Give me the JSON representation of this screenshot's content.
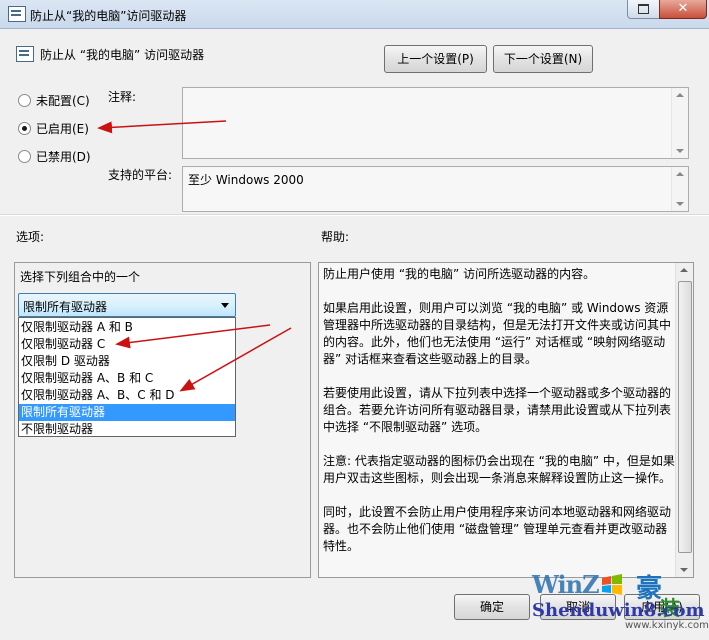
{
  "window": {
    "title": "防止从“我的电脑”访问驱动器",
    "maximize_icon": "maximize-icon",
    "close_label": "✕"
  },
  "header": {
    "policy_title": "防止从 “我的电脑” 访问驱动器",
    "prev_button": "上一个设置(P)",
    "next_button": "下一个设置(N)"
  },
  "state": {
    "options": [
      {
        "label": "未配置(C)",
        "checked": false
      },
      {
        "label": "已启用(E)",
        "checked": true
      },
      {
        "label": "已禁用(D)",
        "checked": false
      }
    ]
  },
  "comment": {
    "label": "注释:",
    "value": ""
  },
  "platform": {
    "label": "支持的平台:",
    "value": "至少 Windows 2000"
  },
  "options_section": {
    "heading": "选项:",
    "combo_label": "选择下列组合中的一个",
    "selected": "限制所有驱动器",
    "items": [
      "仅限制驱动器 A 和 B",
      "仅限制驱动器 C",
      "仅限制 D 驱动器",
      "仅限制驱动器 A、B 和 C",
      "仅限制驱动器 A、B、C 和 D",
      "限制所有驱动器",
      "不限制驱动器"
    ],
    "highlighted_index": 5
  },
  "help_section": {
    "heading": "帮助:",
    "paragraphs": [
      "防止用户使用 “我的电脑” 访问所选驱动器的内容。",
      "如果启用此设置，则用户可以浏览 “我的电脑” 或 Windows 资源管理器中所选驱动器的目录结构，但是无法打开文件夹或访问其中的内容。此外，他们也无法使用 “运行” 对话框或 “映射网络驱动器” 对话框来查看这些驱动器上的目录。",
      "若要使用此设置，请从下拉列表中选择一个驱动器或多个驱动器的组合。若要允许访问所有驱动器目录，请禁用此设置或从下拉列表中选择 “不限制驱动器” 选项。",
      "注意: 代表指定驱动器的图标仍会出现在 “我的电脑” 中，但是如果用户双击这些图标，则会出现一条消息来解释设置防止这一操作。",
      "同时，此设置不会防止用户使用程序来访问本地驱动器和网络驱动器。也不会防止他们使用 “磁盘管理” 管理单元查看并更改驱动器特性。"
    ]
  },
  "footer": {
    "ok": "确定",
    "cancel": "取消",
    "apply": "应用(A)"
  },
  "watermark": {
    "brand": "WinZ",
    "glyph": "豪",
    "glyph2": "装",
    "site": "Shenduwin8.com",
    "url": "www.kxinyk.com"
  },
  "colors": {
    "selection": "#3399ff",
    "annotation_arrow": "#cc1111"
  }
}
